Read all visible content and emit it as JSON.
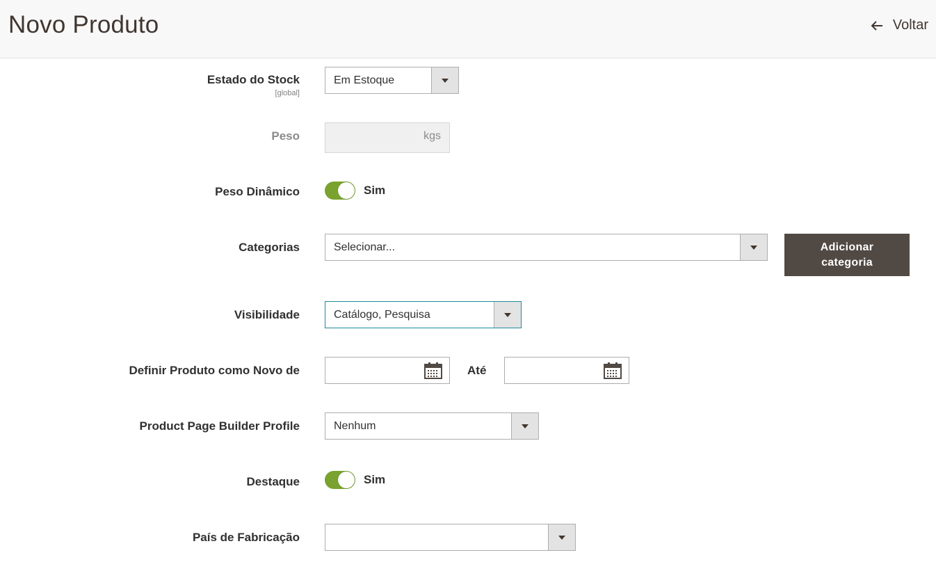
{
  "header": {
    "title": "Novo Produto",
    "back_label": "Voltar"
  },
  "fields": {
    "stock_status": {
      "label": "Estado do Stock",
      "scope": "[global]",
      "value": "Em Estoque"
    },
    "weight": {
      "label": "Peso",
      "addon": "kgs",
      "value": ""
    },
    "dynamic_weight": {
      "label": "Peso Dinâmico",
      "state_label": "Sim",
      "on": true
    },
    "categories": {
      "label": "Categorias",
      "value": "Selecionar...",
      "add_button": "Adicionar categoria"
    },
    "visibility": {
      "label": "Visibilidade",
      "value": "Catálogo, Pesquisa"
    },
    "new_from": {
      "label": "Definir Produto como Novo de",
      "to_label": "Até",
      "from_value": "",
      "to_value": ""
    },
    "page_builder_profile": {
      "label": "Product Page Builder Profile",
      "value": "Nenhum"
    },
    "featured": {
      "label": "Destaque",
      "state_label": "Sim",
      "on": true
    },
    "country_of_manufacture": {
      "label": "País de Fabricação",
      "value": ""
    }
  },
  "colors": {
    "toggle_on": "#79a22e",
    "button_dark": "#514943",
    "title": "#41362f"
  }
}
